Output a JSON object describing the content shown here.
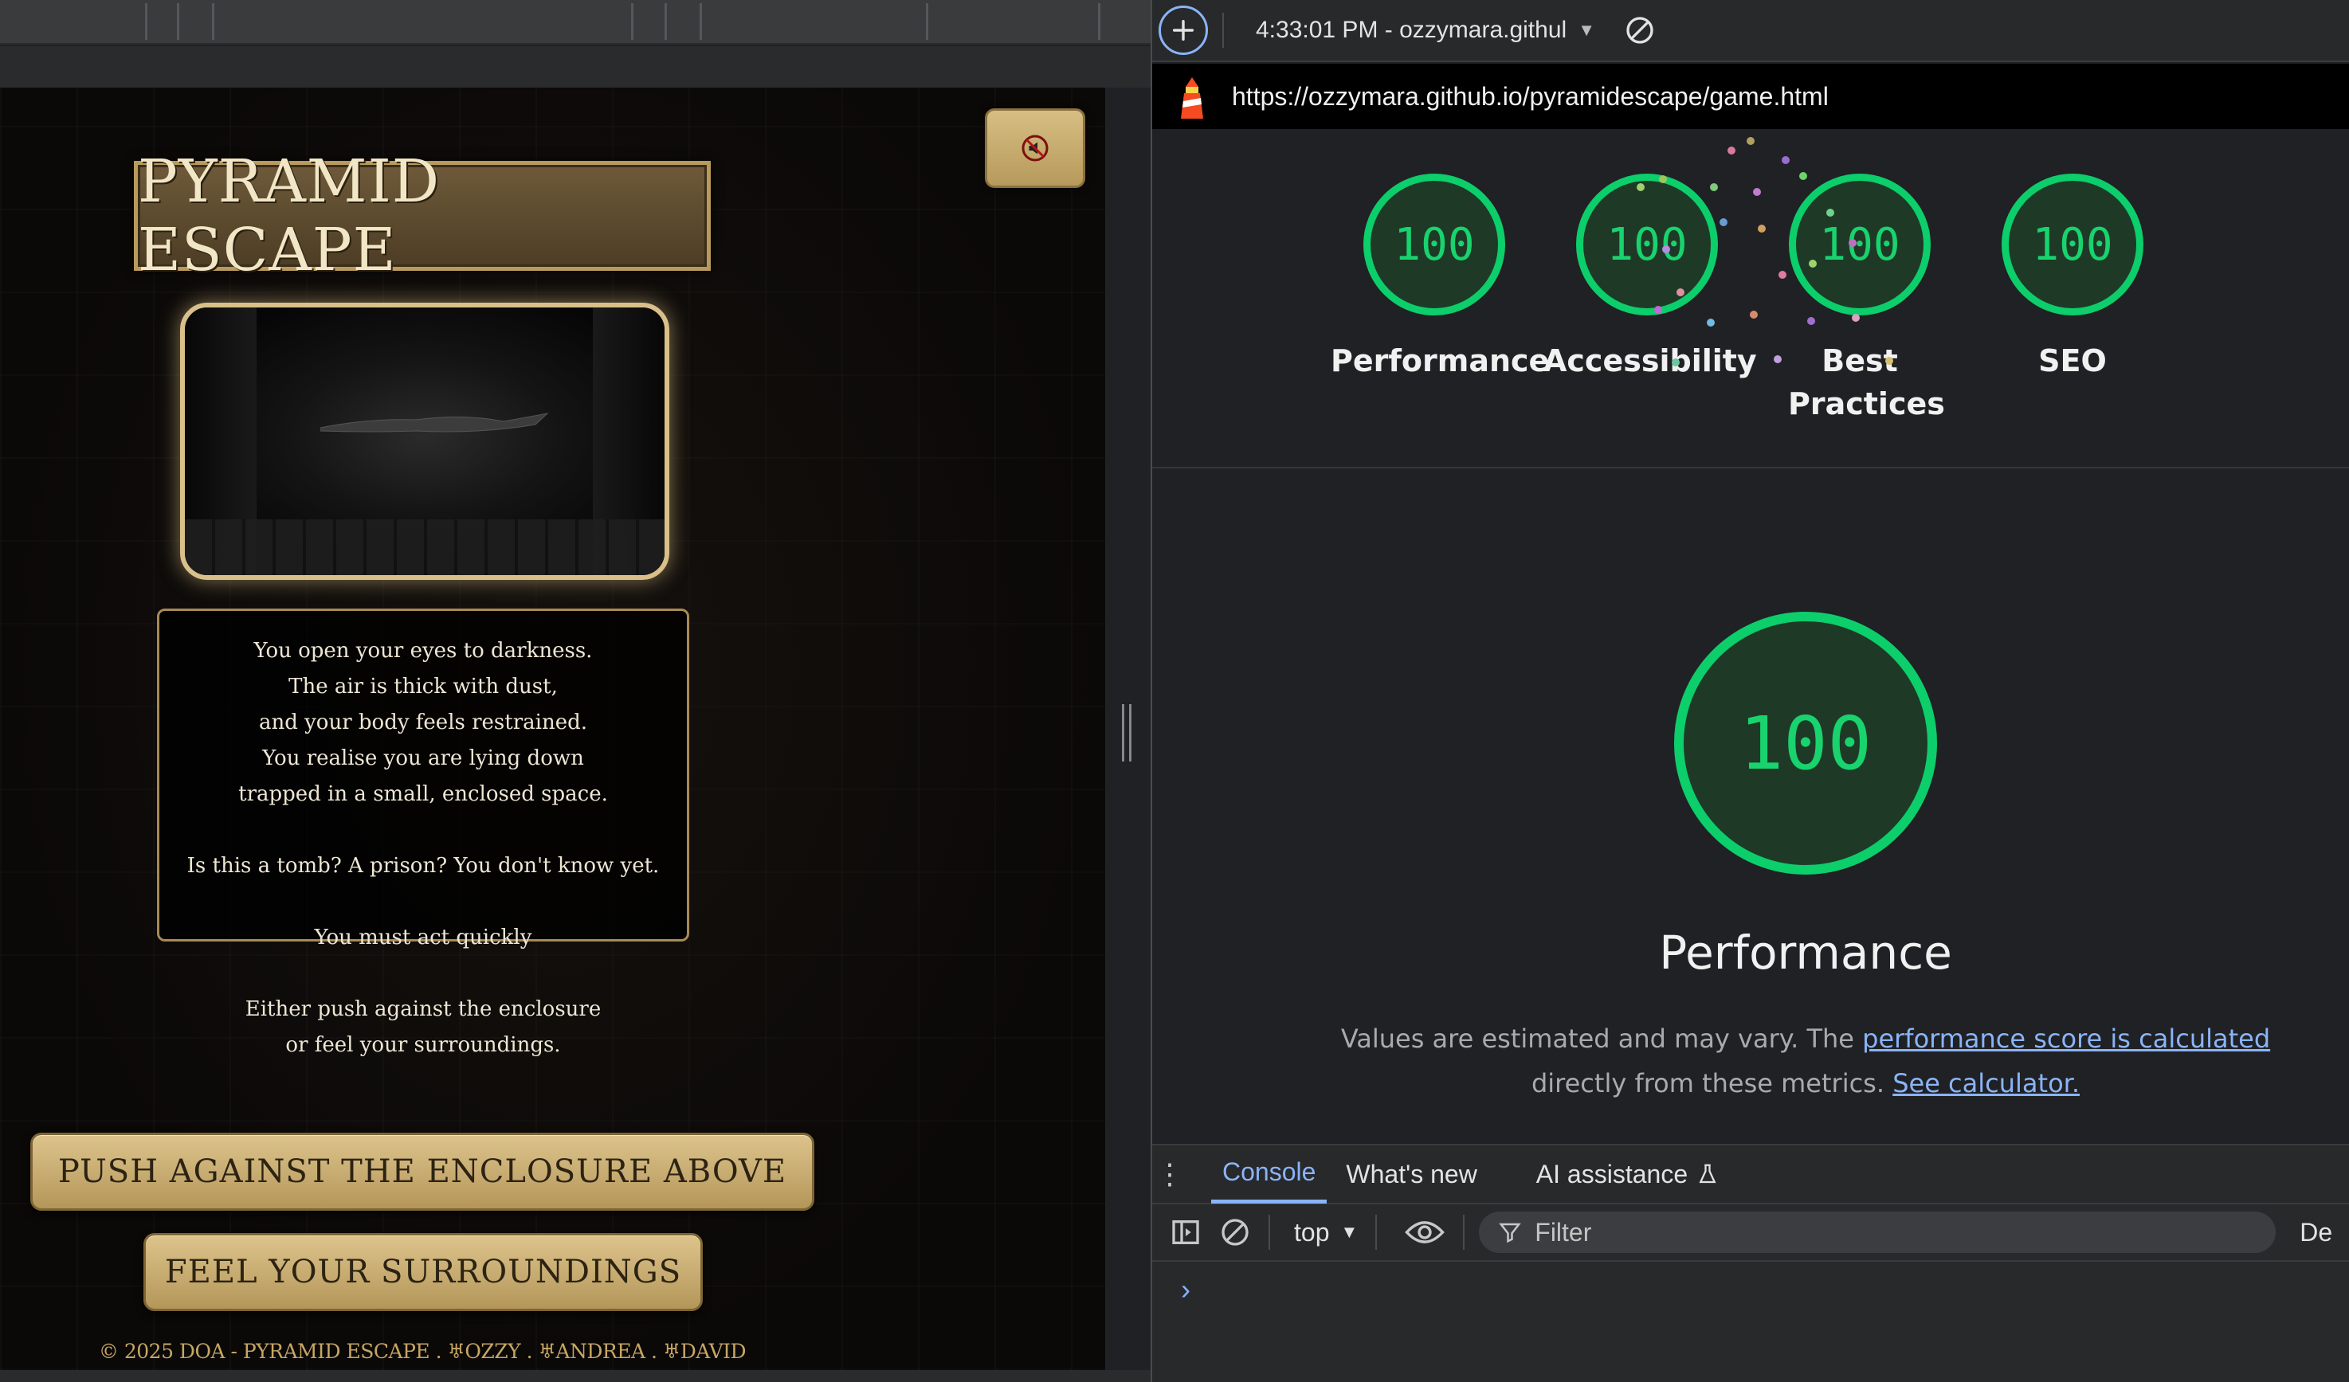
{
  "game": {
    "title": "PYRAMID ESCAPE",
    "story_lines_1": [
      "You open your eyes to darkness.",
      "The air is thick with dust,",
      "and your body feels restrained.",
      "You realise you are lying down",
      "trapped in a small, enclosed space."
    ],
    "story_line_2": "Is this a tomb? A prison? You don't know yet.",
    "story_line_3": "You must act quickly",
    "story_lines_4": [
      "Either push against the enclosure",
      "or feel your surroundings."
    ],
    "choice_1": "PUSH AGAINST THE ENCLOSURE ABOVE",
    "choice_2": "FEEL YOUR SURROUNDINGS",
    "footer": "© 2025 DOA - PYRAMID ESCAPE . ♅OZZY . ♅ANDREA . ♅DAVID"
  },
  "devtools": {
    "report_label": "4:33:01 PM - ozzymara.githul",
    "url": "https://ozzymara.github.io/pyramidescape/game.html",
    "scores": [
      {
        "label": "Performance",
        "value": "100"
      },
      {
        "label": "Accessibility",
        "value": "100"
      },
      {
        "label": "Best Practices",
        "value": "100"
      },
      {
        "label": "SEO",
        "value": "100"
      }
    ],
    "big_score": "100",
    "big_title": "Performance",
    "note_prefix": "Values are estimated and may vary. The ",
    "note_link": "performance score is calculated",
    "note_line2_prefix": "directly from these metrics. ",
    "note_link2": "See calculator.",
    "drawer_tabs": [
      "Console",
      "What's new",
      "AI assistance"
    ],
    "context": "top",
    "filter_placeholder": "Filter",
    "default_levels_cut": "De",
    "prompt": "›",
    "score_color": "#0cce6b",
    "accent": "#8ab4f8"
  }
}
